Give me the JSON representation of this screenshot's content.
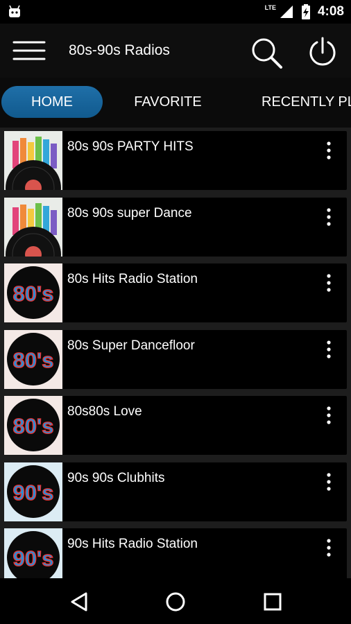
{
  "status_bar": {
    "time": "4:08",
    "network_label": "LTE",
    "icons": [
      "android-notification-icon",
      "signal-icon",
      "battery-charging-icon"
    ]
  },
  "app_bar": {
    "title": "80s-90s Radios",
    "icons": [
      "menu-icon",
      "search-icon",
      "power-icon"
    ]
  },
  "tabs": [
    {
      "label": "HOME",
      "active": true
    },
    {
      "label": "FAVORITE",
      "active": false
    },
    {
      "label": "RECENTLY PLAYED",
      "active": false
    }
  ],
  "stations": [
    {
      "name": "80s 90s PARTY HITS",
      "logo": "equalizer-vinyl-logo"
    },
    {
      "name": "80s 90s super Dance",
      "logo": "equalizer-vinyl-logo"
    },
    {
      "name": "80s Hits Radio Station",
      "logo": "80s-badge-logo"
    },
    {
      "name": "80s Super Dancefloor",
      "logo": "80s-badge-logo"
    },
    {
      "name": "80s80s Love",
      "logo": "80s-badge-logo"
    },
    {
      "name": "90s 90s Clubhits",
      "logo": "90s-badge-logo"
    },
    {
      "name": "90s Hits Radio Station",
      "logo": "90s-badge-logo"
    }
  ],
  "logo_text": {
    "eighties": "80's",
    "nineties": "90's"
  },
  "nav_bar": {
    "icons": [
      "back-icon",
      "home-circle-icon",
      "recents-square-icon"
    ]
  },
  "colors": {
    "active_tab": "#1f6fa8",
    "list_background": "#1d1d1d",
    "card_background": "#000000",
    "logo_blue": "#2a8fd6"
  }
}
